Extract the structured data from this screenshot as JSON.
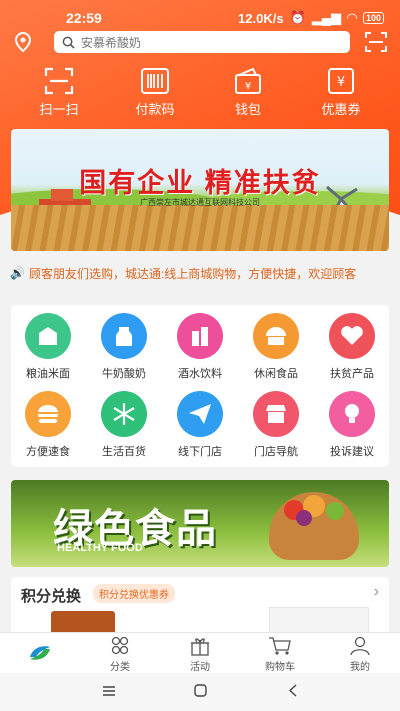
{
  "status_bar": {
    "time": "22:59",
    "speed": "12.0K/s",
    "battery": "100"
  },
  "search": {
    "placeholder": "安慕希酸奶"
  },
  "quick_actions": [
    {
      "label": "扫一扫",
      "icon": "scan-icon"
    },
    {
      "label": "付款码",
      "icon": "barcode-icon"
    },
    {
      "label": "钱包",
      "icon": "wallet-icon"
    },
    {
      "label": "优惠券",
      "icon": "coupon-icon"
    }
  ],
  "banner_top": {
    "title": "国有企业 精准扶贫",
    "subtitle": "广西崇左市城达通互联网科技公司"
  },
  "notice": {
    "text": "顾客朋友们选购，城达通:线上商城购物，方便快捷，欢迎顾客"
  },
  "categories": [
    {
      "label": "粮油米面",
      "icon": "grain-oil-icon",
      "color": "#3ec68a"
    },
    {
      "label": "牛奶酸奶",
      "icon": "milk-icon",
      "color": "#2e9cf2"
    },
    {
      "label": "酒水饮料",
      "icon": "drinks-icon",
      "color": "#ee4f9a"
    },
    {
      "label": "休闲食品",
      "icon": "snack-icon",
      "color": "#f59a33"
    },
    {
      "label": "扶贫产品",
      "icon": "handshake-icon",
      "color": "#f0525a"
    },
    {
      "label": "方便速食",
      "icon": "burger-icon",
      "color": "#f9a23a"
    },
    {
      "label": "生活百货",
      "icon": "snowflake-icon",
      "color": "#2fc07a"
    },
    {
      "label": "线下门店",
      "icon": "paper-plane-icon",
      "color": "#2f9ef0"
    },
    {
      "label": "门店导航",
      "icon": "store-icon",
      "color": "#f2566a"
    },
    {
      "label": "投诉建议",
      "icon": "bulb-icon",
      "color": "#f25e9f"
    }
  ],
  "banner_food": {
    "title": "绿色食品",
    "subtitle": "HEALTHY FOOD"
  },
  "points": {
    "title": "积分兑换",
    "tag": "积分兑换优惠券"
  },
  "tabs": [
    {
      "label": "",
      "icon": "home-logo-icon"
    },
    {
      "label": "分类",
      "icon": "category-icon"
    },
    {
      "label": "活动",
      "icon": "gift-icon"
    },
    {
      "label": "购物车",
      "icon": "cart-icon"
    },
    {
      "label": "我的",
      "icon": "user-icon"
    }
  ],
  "colors": {
    "accent": "#ff5a1f",
    "notice_text": "#e0631a"
  }
}
